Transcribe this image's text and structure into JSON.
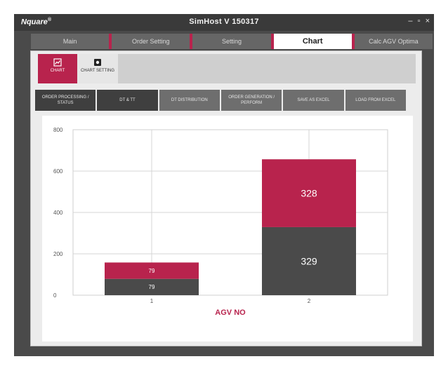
{
  "window": {
    "logo": "Nquare",
    "title": "SimHost V 150317",
    "controls": [
      "–",
      "▫",
      "×"
    ]
  },
  "main_tabs": [
    {
      "label": "Main",
      "active": false
    },
    {
      "label": "Order Setting",
      "active": false
    },
    {
      "label": "Setting",
      "active": false
    },
    {
      "label": "Chart",
      "active": true
    },
    {
      "label": "Calc AGV Optima",
      "active": false
    }
  ],
  "sub_toolbar": {
    "chart_label": "CHART",
    "chart_icon": "chart-icon",
    "setting_label": "CHART SETTING",
    "setting_icon": "gear-icon"
  },
  "chart_menu": [
    {
      "label": "ORDER PROCESSING / STATUS"
    },
    {
      "label": "DT & TT"
    },
    {
      "label": "DT DISTRIBUTION"
    },
    {
      "label": "ORDER GENERATION / PERFORM"
    },
    {
      "label": "SAVE AS EXCEL"
    },
    {
      "label": "LOAD FROM EXCEL"
    }
  ],
  "colors": {
    "accent": "#b8234d",
    "dark": "#4a4a4a"
  },
  "chart_data": {
    "type": "bar",
    "stacked": true,
    "categories": [
      "1",
      "2"
    ],
    "series": [
      {
        "values": [
          79,
          329
        ],
        "color": "#4a4a4a"
      },
      {
        "values": [
          79,
          328
        ],
        "color": "#b8234d"
      }
    ],
    "xlabel": "AGV NO",
    "ylabel": "",
    "ylim": [
      0,
      800
    ],
    "yticks": [
      0,
      200,
      400,
      600,
      800
    ],
    "grid": true
  }
}
